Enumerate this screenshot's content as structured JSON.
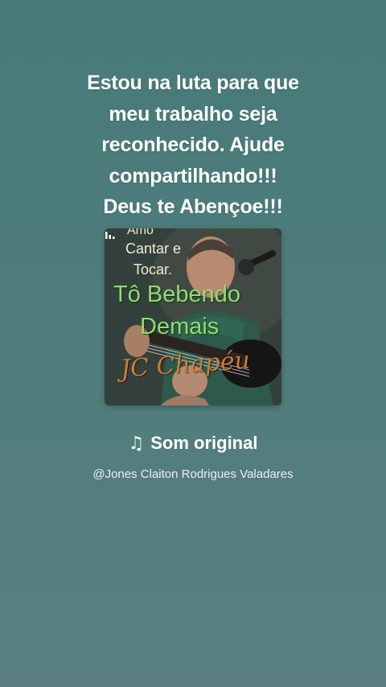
{
  "message": {
    "lines": [
      "Estou na luta para que",
      "meu trabalho seja",
      "reconhecido. Ajude",
      "compartilhando!!!",
      "Deus te Abençoe!!!"
    ]
  },
  "cover": {
    "line_amo": "Amo",
    "line_cantar": "Cantar e",
    "line_tocar": "Tocar.",
    "title_line1": "Tô Bebendo",
    "title_line2": "Demais",
    "artist_signature": "JC Chapéu",
    "text_color": "#8ede6e",
    "signature_color": "#d07a3a"
  },
  "sound": {
    "icon": "music-note-icon",
    "title": "Som original",
    "author": "@Jones Claiton Rodrigues Valadares"
  },
  "colors": {
    "background_top": "#467a79",
    "background_bottom": "#5a7e80",
    "text": "#ffffff"
  }
}
